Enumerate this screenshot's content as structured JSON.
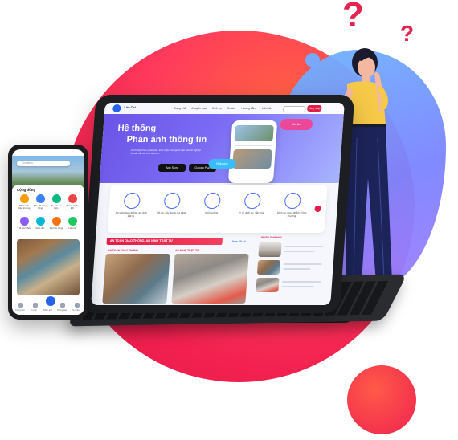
{
  "question_marks": [
    "?",
    "?"
  ],
  "tablet": {
    "nav": {
      "brand": "Lào Cai",
      "items": [
        "Trang chủ",
        "Chuyên mục",
        "Dịch vụ",
        "Tin tức",
        "Hướng dẫn",
        "Liên hệ"
      ],
      "login": "Đăng nhập"
    },
    "hero": {
      "title_line1": "Hệ thống",
      "title_line2": "Phản ánh thông tin",
      "description": "Kênh tiếp nhận phản ánh, kiến nghị của người dân, doanh nghiệp về các vấn đề trên địa bàn.",
      "app_store": "App Store",
      "google_play": "Google Play",
      "bubble1": "Ghi âm",
      "bubble2": "Phản ánh"
    },
    "services": [
      {
        "label": "An toàn giao thông, an ninh trật tự"
      },
      {
        "label": "Đô thị, xây dựng, hạ tầng"
      },
      {
        "label": "Môi trường"
      },
      {
        "label": "Y tế, dịch vụ, văn hóa"
      },
      {
        "label": "Dịch vụ, thực phẩm, công thương"
      }
    ],
    "section_title": "AN TOÀN GIAO THÔNG, AN NINH TRẬT TỰ",
    "sub_heads": [
      "AN TOÀN GIAO THÔNG",
      "AN NINH TRẬT TỰ",
      "PHẢN ÁNH MỚI"
    ],
    "view_all": "Xem tất cả"
  },
  "phone": {
    "search_placeholder": "Tìm kiếm",
    "section_title": "Cộng đồng",
    "icons": [
      {
        "label": "Phản ánh hiện trường",
        "color": "#f59e0b"
      },
      {
        "label": "Bản đồ cộng đồng",
        "color": "#3b82f6"
      },
      {
        "label": "Tin tức sự kiện",
        "color": "#10b981"
      },
      {
        "label": "Thông tin du lịch",
        "color": "#ef4444"
      },
      {
        "label": "Y tế sức khỏe",
        "color": "#8b5cf6"
      },
      {
        "label": "Giáo dục",
        "color": "#06b6d4"
      },
      {
        "label": "Dịch vụ công",
        "color": "#f97316"
      },
      {
        "label": "Liên hệ",
        "color": "#22c55e"
      }
    ],
    "tabs": [
      "Trang chủ",
      "Tin tức",
      "Phản ánh",
      "Thông báo",
      "Cá nhân"
    ]
  },
  "colors": {
    "accent_red": "#e4244f",
    "accent_blue": "#6a52e6"
  }
}
